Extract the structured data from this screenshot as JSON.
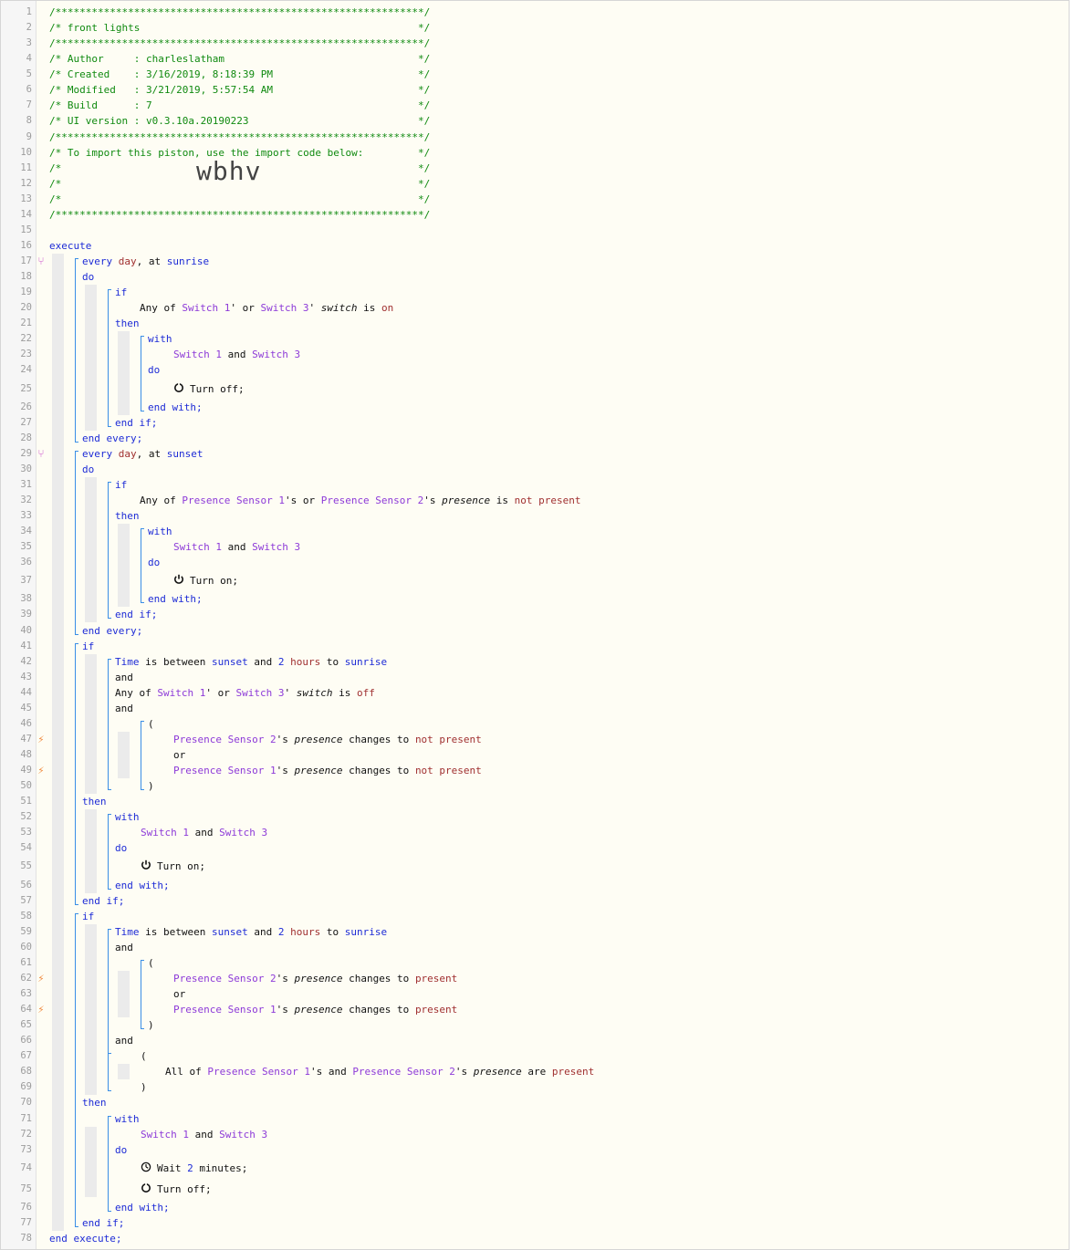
{
  "editor": {
    "lines": [
      {
        "n": "1",
        "indent": 0,
        "segs": [
          [
            "c",
            "/*************************************************************/"
          ]
        ]
      },
      {
        "n": "2",
        "indent": 0,
        "segs": [
          [
            "c",
            "/* front lights                                              */"
          ]
        ]
      },
      {
        "n": "3",
        "indent": 0,
        "segs": [
          [
            "c",
            "/*************************************************************/"
          ]
        ]
      },
      {
        "n": "4",
        "indent": 0,
        "segs": [
          [
            "c",
            "/* Author     : charleslatham                                */"
          ]
        ]
      },
      {
        "n": "5",
        "indent": 0,
        "segs": [
          [
            "c",
            "/* Created    : 3/16/2019, 8:18:39 PM                        */"
          ]
        ]
      },
      {
        "n": "6",
        "indent": 0,
        "segs": [
          [
            "c",
            "/* Modified   : 3/21/2019, 5:57:54 AM                        */"
          ]
        ]
      },
      {
        "n": "7",
        "indent": 0,
        "segs": [
          [
            "c",
            "/* Build      : 7                                            */"
          ]
        ]
      },
      {
        "n": "8",
        "indent": 0,
        "segs": [
          [
            "c",
            "/* UI version : v0.3.10a.20190223                            */"
          ]
        ]
      },
      {
        "n": "9",
        "indent": 0,
        "segs": [
          [
            "c",
            "/*************************************************************/"
          ]
        ]
      },
      {
        "n": "10",
        "indent": 0,
        "segs": [
          [
            "c",
            "/* To import this piston, use the import code below:         */"
          ]
        ]
      },
      {
        "n": "11",
        "indent": 0,
        "segs": [
          [
            "c",
            "/*                                                           */"
          ]
        ]
      },
      {
        "n": "12",
        "indent": 0,
        "segs": [
          [
            "c",
            "/*                                                           */"
          ]
        ]
      },
      {
        "n": "13",
        "indent": 0,
        "segs": [
          [
            "c",
            "/*                                                           */"
          ]
        ]
      },
      {
        "n": "14",
        "indent": 0,
        "segs": [
          [
            "c",
            "/*************************************************************/"
          ]
        ]
      },
      {
        "n": "15",
        "indent": 0,
        "segs": []
      },
      {
        "n": "16",
        "indent": 0,
        "segs": [
          [
            "k",
            "execute"
          ]
        ]
      },
      {
        "n": "17",
        "indent": 36,
        "mark": "ev",
        "segs": [
          [
            "k",
            "every "
          ],
          [
            "r",
            "day"
          ],
          [
            "t",
            ", at "
          ],
          [
            "k",
            "sunrise"
          ]
        ]
      },
      {
        "n": "18",
        "indent": 36,
        "segs": [
          [
            "k",
            "do"
          ]
        ]
      },
      {
        "n": "19",
        "indent": 72,
        "segs": [
          [
            "k",
            "if"
          ]
        ]
      },
      {
        "n": "20",
        "indent": 99,
        "segs": [
          [
            "t",
            "Any of "
          ],
          [
            "v",
            "Switch 1"
          ],
          [
            "t",
            "' or "
          ],
          [
            "v",
            "Switch 3"
          ],
          [
            "t",
            "' "
          ],
          [
            "i",
            "switch"
          ],
          [
            "t",
            " is "
          ],
          [
            "r",
            "on"
          ]
        ]
      },
      {
        "n": "21",
        "indent": 72,
        "segs": [
          [
            "k",
            "then"
          ]
        ]
      },
      {
        "n": "22",
        "indent": 108,
        "segs": [
          [
            "k",
            "with"
          ]
        ]
      },
      {
        "n": "23",
        "indent": 136,
        "segs": [
          [
            "v",
            "Switch 1"
          ],
          [
            "t",
            " and "
          ],
          [
            "v",
            "Switch 3"
          ]
        ]
      },
      {
        "n": "24",
        "indent": 108,
        "segs": [
          [
            "k",
            "do"
          ]
        ]
      },
      {
        "n": "25",
        "indent": 136,
        "icon": "power-off-icon",
        "segs": [
          [
            "t",
            "Turn off;"
          ]
        ]
      },
      {
        "n": "26",
        "indent": 108,
        "segs": [
          [
            "k",
            "end with;"
          ]
        ]
      },
      {
        "n": "27",
        "indent": 72,
        "segs": [
          [
            "k",
            "end if;"
          ]
        ]
      },
      {
        "n": "28",
        "indent": 36,
        "segs": [
          [
            "k",
            "end every;"
          ]
        ]
      },
      {
        "n": "29",
        "indent": 36,
        "mark": "ev",
        "segs": [
          [
            "k",
            "every "
          ],
          [
            "r",
            "day"
          ],
          [
            "t",
            ", at "
          ],
          [
            "k",
            "sunset"
          ]
        ]
      },
      {
        "n": "30",
        "indent": 36,
        "segs": [
          [
            "k",
            "do"
          ]
        ]
      },
      {
        "n": "31",
        "indent": 72,
        "segs": [
          [
            "k",
            "if"
          ]
        ]
      },
      {
        "n": "32",
        "indent": 99,
        "segs": [
          [
            "t",
            "Any of "
          ],
          [
            "v",
            "Presence Sensor 1"
          ],
          [
            "t",
            "'s or "
          ],
          [
            "v",
            "Presence Sensor 2"
          ],
          [
            "t",
            "'s "
          ],
          [
            "i",
            "presence"
          ],
          [
            "t",
            " is "
          ],
          [
            "r",
            "not present"
          ]
        ]
      },
      {
        "n": "33",
        "indent": 72,
        "segs": [
          [
            "k",
            "then"
          ]
        ]
      },
      {
        "n": "34",
        "indent": 108,
        "segs": [
          [
            "k",
            "with"
          ]
        ]
      },
      {
        "n": "35",
        "indent": 136,
        "segs": [
          [
            "v",
            "Switch 1"
          ],
          [
            "t",
            " and "
          ],
          [
            "v",
            "Switch 3"
          ]
        ]
      },
      {
        "n": "36",
        "indent": 108,
        "segs": [
          [
            "k",
            "do"
          ]
        ]
      },
      {
        "n": "37",
        "indent": 136,
        "icon": "power-on-icon",
        "segs": [
          [
            "t",
            "Turn on;"
          ]
        ]
      },
      {
        "n": "38",
        "indent": 108,
        "segs": [
          [
            "k",
            "end with;"
          ]
        ]
      },
      {
        "n": "39",
        "indent": 72,
        "segs": [
          [
            "k",
            "end if;"
          ]
        ]
      },
      {
        "n": "40",
        "indent": 36,
        "segs": [
          [
            "k",
            "end every;"
          ]
        ]
      },
      {
        "n": "41",
        "indent": 36,
        "segs": [
          [
            "k",
            "if"
          ]
        ]
      },
      {
        "n": "42",
        "indent": 72,
        "segs": [
          [
            "k",
            "Time"
          ],
          [
            "t",
            " is between "
          ],
          [
            "k",
            "sunset"
          ],
          [
            "t",
            " and "
          ],
          [
            "n",
            "2"
          ],
          [
            "t",
            " "
          ],
          [
            "r",
            "hours"
          ],
          [
            "t",
            " to "
          ],
          [
            "k",
            "sunrise"
          ]
        ]
      },
      {
        "n": "43",
        "indent": 72,
        "segs": [
          [
            "t",
            "and"
          ]
        ]
      },
      {
        "n": "44",
        "indent": 72,
        "segs": [
          [
            "t",
            "Any of "
          ],
          [
            "v",
            "Switch 1"
          ],
          [
            "t",
            "' or "
          ],
          [
            "v",
            "Switch 3"
          ],
          [
            "t",
            "' "
          ],
          [
            "i",
            "switch"
          ],
          [
            "t",
            " is "
          ],
          [
            "r",
            "off"
          ]
        ]
      },
      {
        "n": "45",
        "indent": 72,
        "segs": [
          [
            "t",
            "and"
          ]
        ]
      },
      {
        "n": "46",
        "indent": 108,
        "segs": [
          [
            "t",
            "("
          ]
        ]
      },
      {
        "n": "47",
        "indent": 136,
        "mark": "trig",
        "segs": [
          [
            "v",
            "Presence Sensor 2"
          ],
          [
            "t",
            "'s "
          ],
          [
            "i",
            "presence"
          ],
          [
            "t",
            " changes to "
          ],
          [
            "r",
            "not present"
          ]
        ]
      },
      {
        "n": "48",
        "indent": 136,
        "segs": [
          [
            "t",
            "or"
          ]
        ]
      },
      {
        "n": "49",
        "indent": 136,
        "mark": "trig",
        "segs": [
          [
            "v",
            "Presence Sensor 1"
          ],
          [
            "t",
            "'s "
          ],
          [
            "i",
            "presence"
          ],
          [
            "t",
            " changes to "
          ],
          [
            "r",
            "not present"
          ]
        ]
      },
      {
        "n": "50",
        "indent": 108,
        "segs": [
          [
            "t",
            ")"
          ]
        ]
      },
      {
        "n": "51",
        "indent": 36,
        "segs": [
          [
            "k",
            "then"
          ]
        ]
      },
      {
        "n": "52",
        "indent": 72,
        "segs": [
          [
            "k",
            "with"
          ]
        ]
      },
      {
        "n": "53",
        "indent": 100,
        "segs": [
          [
            "v",
            "Switch 1"
          ],
          [
            "t",
            " and "
          ],
          [
            "v",
            "Switch 3"
          ]
        ]
      },
      {
        "n": "54",
        "indent": 72,
        "segs": [
          [
            "k",
            "do"
          ]
        ]
      },
      {
        "n": "55",
        "indent": 100,
        "icon": "power-on-icon",
        "segs": [
          [
            "t",
            "Turn on;"
          ]
        ]
      },
      {
        "n": "56",
        "indent": 72,
        "segs": [
          [
            "k",
            "end with;"
          ]
        ]
      },
      {
        "n": "57",
        "indent": 36,
        "segs": [
          [
            "k",
            "end if;"
          ]
        ]
      },
      {
        "n": "58",
        "indent": 36,
        "segs": [
          [
            "k",
            "if"
          ]
        ]
      },
      {
        "n": "59",
        "indent": 72,
        "segs": [
          [
            "k",
            "Time"
          ],
          [
            "t",
            " is between "
          ],
          [
            "k",
            "sunset"
          ],
          [
            "t",
            " and "
          ],
          [
            "n",
            "2"
          ],
          [
            "t",
            " "
          ],
          [
            "r",
            "hours"
          ],
          [
            "t",
            " to "
          ],
          [
            "k",
            "sunrise"
          ]
        ]
      },
      {
        "n": "60",
        "indent": 72,
        "segs": [
          [
            "t",
            "and"
          ]
        ]
      },
      {
        "n": "61",
        "indent": 108,
        "segs": [
          [
            "t",
            "("
          ]
        ]
      },
      {
        "n": "62",
        "indent": 136,
        "mark": "trig",
        "segs": [
          [
            "v",
            "Presence Sensor 2"
          ],
          [
            "t",
            "'s "
          ],
          [
            "i",
            "presence"
          ],
          [
            "t",
            " changes to "
          ],
          [
            "r",
            "present"
          ]
        ]
      },
      {
        "n": "63",
        "indent": 136,
        "segs": [
          [
            "t",
            "or"
          ]
        ]
      },
      {
        "n": "64",
        "indent": 136,
        "mark": "trig",
        "segs": [
          [
            "v",
            "Presence Sensor 1"
          ],
          [
            "t",
            "'s "
          ],
          [
            "i",
            "presence"
          ],
          [
            "t",
            " changes to "
          ],
          [
            "r",
            "present"
          ]
        ]
      },
      {
        "n": "65",
        "indent": 108,
        "segs": [
          [
            "t",
            ")"
          ]
        ]
      },
      {
        "n": "66",
        "indent": 72,
        "segs": [
          [
            "t",
            "and"
          ]
        ]
      },
      {
        "n": "67",
        "indent": 100,
        "segs": [
          [
            "t",
            "("
          ]
        ]
      },
      {
        "n": "68",
        "indent": 127,
        "segs": [
          [
            "t",
            "All of "
          ],
          [
            "v",
            "Presence Sensor 1"
          ],
          [
            "t",
            "'s and "
          ],
          [
            "v",
            "Presence Sensor 2"
          ],
          [
            "t",
            "'s "
          ],
          [
            "i",
            "presence"
          ],
          [
            "t",
            " are "
          ],
          [
            "r",
            "present"
          ]
        ]
      },
      {
        "n": "69",
        "indent": 100,
        "segs": [
          [
            "t",
            ")"
          ]
        ]
      },
      {
        "n": "70",
        "indent": 36,
        "segs": [
          [
            "k",
            "then"
          ]
        ]
      },
      {
        "n": "71",
        "indent": 72,
        "segs": [
          [
            "k",
            "with"
          ]
        ]
      },
      {
        "n": "72",
        "indent": 100,
        "segs": [
          [
            "v",
            "Switch 1"
          ],
          [
            "t",
            " and "
          ],
          [
            "v",
            "Switch 3"
          ]
        ]
      },
      {
        "n": "73",
        "indent": 72,
        "segs": [
          [
            "k",
            "do"
          ]
        ]
      },
      {
        "n": "74",
        "indent": 100,
        "icon": "clock-icon",
        "segs": [
          [
            "t",
            "Wait "
          ],
          [
            "n",
            "2"
          ],
          [
            "t",
            " minutes;"
          ]
        ]
      },
      {
        "n": "75",
        "indent": 100,
        "icon": "power-off-icon",
        "segs": [
          [
            "t",
            "Turn off;"
          ]
        ]
      },
      {
        "n": "76",
        "indent": 72,
        "segs": [
          [
            "k",
            "end with;"
          ]
        ]
      },
      {
        "n": "77",
        "indent": 36,
        "segs": [
          [
            "k",
            "end if;"
          ]
        ]
      },
      {
        "n": "78",
        "indent": 0,
        "segs": [
          [
            "k",
            "end execute;"
          ]
        ]
      }
    ],
    "import_code": "wbhv",
    "colors": {
      "comment": "#108a10",
      "keyword": "#1d2bd6",
      "device": "#8d3ad8",
      "value": "#a03030",
      "gutter_bg": "#f6f6f6",
      "editor_bg": "#fefdf4",
      "block_line": "#3a8ee6",
      "event_marker": "#d060d0",
      "trigger_marker": "#f0883a"
    }
  }
}
